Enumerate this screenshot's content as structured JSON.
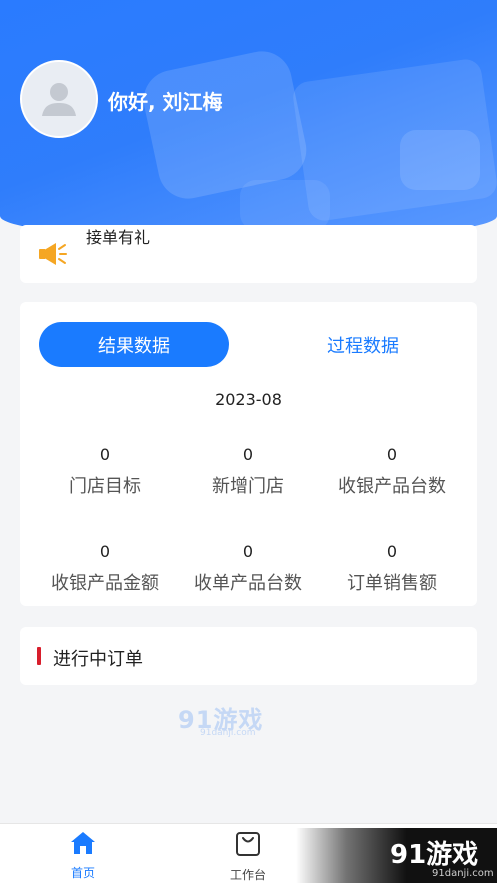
{
  "header": {
    "greeting": "你好, 刘江梅",
    "bg_color": "#2a7bff"
  },
  "notice": {
    "icon": "megaphone-icon",
    "text": "接单有礼",
    "icon_color": "#f5a623"
  },
  "stats": {
    "tabs": [
      {
        "label": "结果数据",
        "active": true
      },
      {
        "label": "过程数据",
        "active": false
      }
    ],
    "month": "2023-08",
    "metrics": [
      {
        "value": "0",
        "label": "门店目标"
      },
      {
        "value": "0",
        "label": "新增门店"
      },
      {
        "value": "0",
        "label": "收银产品台数"
      },
      {
        "value": "0",
        "label": "收银产品金额"
      },
      {
        "value": "0",
        "label": "收单产品台数"
      },
      {
        "value": "0",
        "label": "订单销售额"
      }
    ]
  },
  "in_progress": {
    "title": "进行中订单",
    "accent_color": "#d81e2c"
  },
  "watermark": {
    "text": "91游戏",
    "sub": "91danji.com"
  },
  "bottom_nav": [
    {
      "label": "首页",
      "icon": "home-icon",
      "active": true
    },
    {
      "label": "工作台",
      "icon": "bag-icon",
      "active": false
    }
  ],
  "logo_overlay": {
    "text": "91游戏",
    "sub": "91danji.com"
  },
  "accent_color": "#1a7bff"
}
